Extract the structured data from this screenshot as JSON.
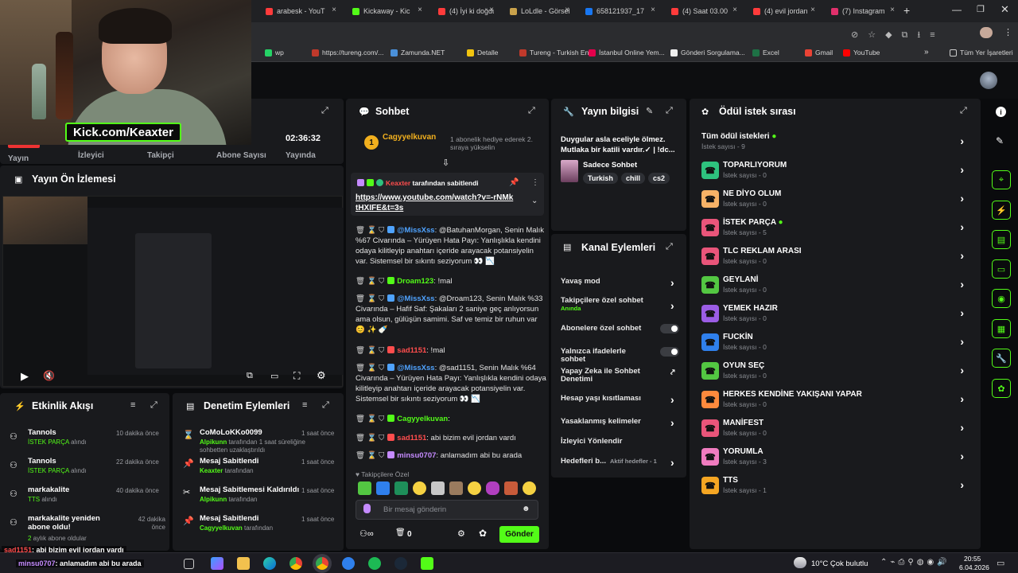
{
  "browser": {
    "tabs": [
      {
        "label": "arabesk - YouT",
        "color": "#ff3b3b"
      },
      {
        "label": "Kickaway - Kic",
        "color": "#53fc18"
      },
      {
        "label": "(4) İyi ki doğdu",
        "color": "#ff3b3b"
      },
      {
        "label": "LoLdle - Görsel",
        "color": "#c9a24b"
      },
      {
        "label": "658121937_17",
        "color": "#1877f2"
      },
      {
        "label": "(4) Saat 03.00",
        "color": "#ff3b3b"
      },
      {
        "label": "(4) evil jordan",
        "color": "#ff3b3b"
      },
      {
        "label": "(7) Instagram",
        "color": "#e1306c"
      }
    ],
    "bookmarks": [
      {
        "label": "wp",
        "color": "#25d366"
      },
      {
        "label": "https://tureng.com/...",
        "color": "#c0392b"
      },
      {
        "label": "Zamunda.NET",
        "color": "#4a90d9"
      },
      {
        "label": "Detalle",
        "color": "#f1c40f"
      },
      {
        "label": "Tureng - Turkish En...",
        "color": "#c0392b"
      },
      {
        "label": "İstanbul Online Yem...",
        "color": "#e5004c"
      },
      {
        "label": "Gönderi Sorgulama...",
        "color": "#eeeeee"
      },
      {
        "label": "Excel",
        "color": "#1e7145"
      },
      {
        "label": "Gmail",
        "color": "#ea4335"
      },
      {
        "label": "YouTube",
        "color": "#ff0000"
      }
    ],
    "all_bookmarks": "Tüm Yer İşaretleri"
  },
  "webcam": {
    "label": "Kick.com/Keaxter"
  },
  "stats": {
    "yayin_badge": "YAYINDA",
    "uptime": "02:36:32",
    "labels": [
      "Yayın",
      "İzleyici",
      "Takipçi",
      "Abone Sayısı",
      "Yayında"
    ]
  },
  "preview": {
    "title": "Yayın Ön İzlemesi"
  },
  "activity": {
    "title": "Etkinlik Akışı",
    "items": [
      {
        "name": "Tannols",
        "detail_accent": "İSTEK PARÇA",
        "detail": " alındı",
        "time": "10 dakika önce"
      },
      {
        "name": "Tannols",
        "detail_accent": "İSTEK PARÇA",
        "detail": " alındı",
        "time": "22 dakika önce"
      },
      {
        "name": "markakalite",
        "detail_accent": "TTS",
        "detail": " alındı",
        "time": "40 dakika önce"
      },
      {
        "name": "markakalite yeniden abone oldu!",
        "detail_accent": "2",
        "detail": " aylık abone oldular",
        "time": "42 dakika önce"
      }
    ]
  },
  "moderation": {
    "title": "Denetim Eylemleri",
    "items": [
      {
        "title": "CoMoLoKKo0099",
        "by": "Alpikunn",
        "rest": " tarafından 1 saat süreliğine sohbetten uzaklaştırıldı",
        "time": "1 saat önce"
      },
      {
        "title": "Mesaj Sabitlendi",
        "by": "Keaxter",
        "rest": " tarafından",
        "time": "1 saat önce"
      },
      {
        "title": "Mesaj Sabitlemesi Kaldırıldı",
        "by": "Alpikunn",
        "rest": " tarafından",
        "time": "1 saat önce"
      },
      {
        "title": "Mesaj Sabitlendi",
        "by": "Cagyyelkuvan",
        "rest": " tarafından",
        "time": "1 saat önce"
      }
    ]
  },
  "chat": {
    "title": "Sohbet",
    "gifter": {
      "name": "Cagyyelkuvan",
      "rank": "1",
      "note": "1 abonelik hediye ederek 2. sıraya yükselin"
    },
    "pinned": {
      "by": "Keaxter",
      "by_suffix": " tarafından sabitlendi",
      "link": "https://www.youtube.com/watch?v=-rNMktHXIFE&t=3s"
    },
    "messages": [
      {
        "user": "@MissXss",
        "color": "#4fa3ff",
        "text": ": @BatuhanMorgan, Senin Malık %67 Civarında – Yürüyen Hata Payı: Yanlışlıkla kendini odaya kilitleyip anahtarı içeride arayacak potansiyelin var. Sistemsel bir sıkıntı seziyorum 👀 📉"
      },
      {
        "user": "Droam123",
        "color": "#53fc18",
        "text": ": !mal"
      },
      {
        "user": "@MissXss",
        "color": "#4fa3ff",
        "text": ": @Droam123, Senin Malık %33 Civarında – Hafif Saf: Şakaları 2 saniye geç anlıyorsun ama olsun, gülüşün samimi. Saf ve temiz bir ruhun var 😊 ✨ 🍼"
      },
      {
        "user": "sad1151",
        "color": "#ff4d4d",
        "text": ": !mal"
      },
      {
        "user": "@MissXss",
        "color": "#4fa3ff",
        "text": ": @sad1151, Senin Malık %64 Civarında – Yürüyen Hata Payı: Yanlışlıkla kendini odaya kilitleyip anahtarı içeride arayacak potansiyelin var. Sistemsel bir sıkıntı seziyorum 👀 📉"
      },
      {
        "user": "Cagyyelkuvan",
        "color": "#53fc18",
        "text": ": "
      },
      {
        "user": "sad1151",
        "color": "#ff4d4d",
        "text": ": abi bizim evil jordan vardı"
      },
      {
        "user": "minsu0707",
        "color": "#c58bff",
        "text": ": anlamadım abi bu arada"
      }
    ],
    "followers_only": "Takipçilere Özel",
    "input_placeholder": "Bir mesaj gönderin",
    "count": "0",
    "send": "Gönder"
  },
  "stream_info": {
    "title": "Yayın bilgisi",
    "text": "Duygular asla eceliyle ölmez. Mutlaka bir katili vardır.✓ | !dc...",
    "category": "Sadece Sohbet",
    "tags": [
      "Turkish",
      "chill",
      "cs2"
    ]
  },
  "channel_actions": {
    "title": "Kanal Eylemleri",
    "items": [
      {
        "label": "Yavaş mod",
        "kind": "chevron"
      },
      {
        "label": "Takipçilere özel sohbet",
        "sub": "Anında",
        "kind": "chevron"
      },
      {
        "label": "Abonelere özel sohbet",
        "kind": "toggle"
      },
      {
        "label": "Yalnızca ifadelerle sohbet",
        "kind": "toggle"
      },
      {
        "label": "Yapay Zeka ile Sohbet Denetimi",
        "kind": "external"
      },
      {
        "label": "Hesap yaşı kısıtlaması",
        "kind": "chevron"
      },
      {
        "label": "Yasaklanmış kelimeler",
        "kind": "chevron"
      },
      {
        "label": "İzleyici Yönlendir",
        "kind": "none"
      },
      {
        "label": "Hedefleri b...",
        "sub": "Aktif hedefler - 1",
        "kind": "chevron"
      }
    ]
  },
  "rewards": {
    "title": "Ödül istek sırası",
    "all": {
      "title": "Tüm ödül istekleri",
      "sub": "İstek sayısı - 9"
    },
    "items": [
      {
        "name": "TOPARLIYORUM",
        "sub": "İstek sayısı - 0",
        "color": "#2ec27e",
        "dot": false
      },
      {
        "name": "NE DİYO OLUM",
        "sub": "İstek sayısı - 0",
        "color": "#f7b267",
        "dot": false
      },
      {
        "name": "İSTEK PARÇA",
        "sub": "İstek sayısı - 5",
        "color": "#e9557a",
        "dot": true
      },
      {
        "name": "TLC REKLAM ARASI",
        "sub": "İstek sayısı - 0",
        "color": "#e9557a",
        "dot": false
      },
      {
        "name": "GEYLANİ",
        "sub": "İstek sayısı - 0",
        "color": "#53c742",
        "dot": false
      },
      {
        "name": "YEMEK HAZIR",
        "sub": "İstek sayısı - 0",
        "color": "#9b5de5",
        "dot": false
      },
      {
        "name": "FUCKİN",
        "sub": "İstek sayısı - 0",
        "color": "#2f80ed",
        "dot": false
      },
      {
        "name": "OYUN SEÇ",
        "sub": "İstek sayısı - 0",
        "color": "#53c742",
        "dot": false
      },
      {
        "name": "HERKES KENDİNE YAKIŞANI YAPAR",
        "sub": "İstek sayısı - 0",
        "color": "#ff8a3d",
        "dot": false
      },
      {
        "name": "MANİFEST",
        "sub": "İstek sayısı - 0",
        "color": "#e9557a",
        "dot": false
      },
      {
        "name": "YORUMLA",
        "sub": "İstek sayısı - 3",
        "color": "#f07cc0",
        "dot": false
      },
      {
        "name": "TTS",
        "sub": "İstek sayısı - 1",
        "color": "#f5a623",
        "dot": false
      }
    ]
  },
  "overlay_chat": [
    {
      "user": "sad1151",
      "text": ": abi bizim evil jordan vardı"
    },
    {
      "user": "minsu0707",
      "text": ": anlamadım abi bu arada"
    }
  ],
  "taskbar": {
    "weather": "10°C  Çok bulutlu",
    "time": "20:55",
    "date": "6.04.2026"
  }
}
